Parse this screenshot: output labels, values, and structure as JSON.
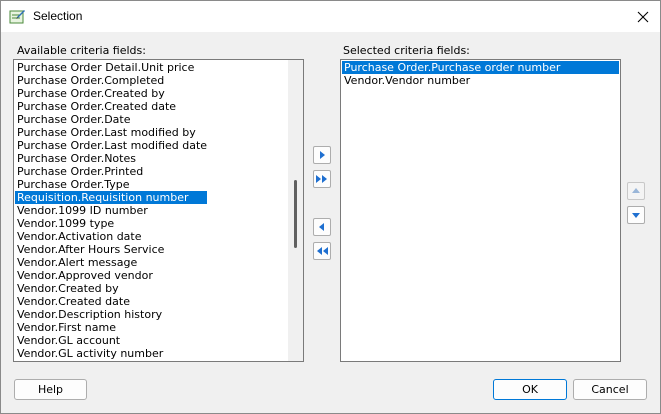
{
  "window": {
    "title": "Selection"
  },
  "available": {
    "label": "Available criteria fields:",
    "items": [
      "Purchase Order Detail.Unit price",
      "Purchase Order.Completed",
      "Purchase Order.Created by",
      "Purchase Order.Created date",
      "Purchase Order.Date",
      "Purchase Order.Last modified by",
      "Purchase Order.Last modified date",
      "Purchase Order.Notes",
      "Purchase Order.Printed",
      "Purchase Order.Type",
      "Requisition.Requisition number",
      "Vendor.1099 ID number",
      "Vendor.1099 type",
      "Vendor.Activation date",
      "Vendor.After Hours Service",
      "Vendor.Alert message",
      "Vendor.Approved vendor",
      "Vendor.Created by",
      "Vendor.Created date",
      "Vendor.Description history",
      "Vendor.First name",
      "Vendor.GL account",
      "Vendor.GL activity number"
    ],
    "selected_index": 10
  },
  "selected_fields": {
    "label": "Selected criteria fields:",
    "items": [
      "Purchase Order.Purchase order number",
      "Vendor.Vendor number"
    ],
    "selected_index": 0
  },
  "buttons": {
    "help": "Help",
    "ok": "OK",
    "cancel": "Cancel"
  },
  "colors": {
    "selection": "#0078d7",
    "arrow_blue": "#1e6fd0"
  }
}
